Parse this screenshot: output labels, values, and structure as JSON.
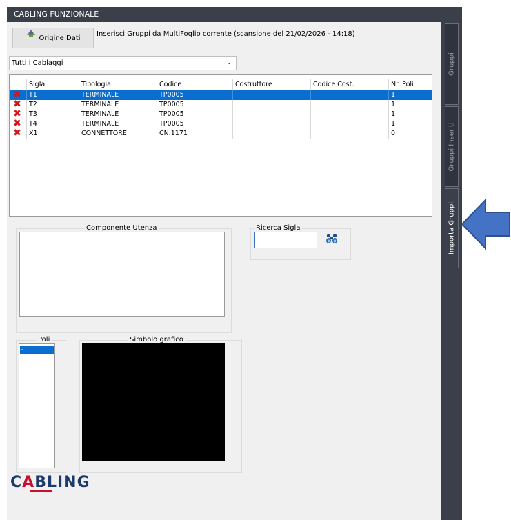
{
  "window": {
    "title": "CABLING FUNZIONALE"
  },
  "toolbar": {
    "origine_label": "Origine Dati",
    "scan_text": "Inserisci Gruppi da MultiFoglio corrente  (scansione del 21/02/2026 - 14:18)"
  },
  "filter": {
    "selected": "Tutti i Cablaggi"
  },
  "table": {
    "columns": [
      "Sigla",
      "Tipologia",
      "Codice",
      "Costruttore",
      "Codice Cost.",
      "Nr. Poli"
    ],
    "rows": [
      {
        "sigla": "T1",
        "tipologia": "TERMINALE",
        "codice": "TP0005",
        "costruttore": "",
        "codice_cost": "",
        "nr_poli": "1",
        "selected": true
      },
      {
        "sigla": "T2",
        "tipologia": "TERMINALE",
        "codice": "TP0005",
        "costruttore": "",
        "codice_cost": "",
        "nr_poli": "1",
        "selected": false
      },
      {
        "sigla": "T3",
        "tipologia": "TERMINALE",
        "codice": "TP0005",
        "costruttore": "",
        "codice_cost": "",
        "nr_poli": "1",
        "selected": false
      },
      {
        "sigla": "T4",
        "tipologia": "TERMINALE",
        "codice": "TP0005",
        "costruttore": "",
        "codice_cost": "",
        "nr_poli": "1",
        "selected": false
      },
      {
        "sigla": "X1",
        "tipologia": "CONNETTORE",
        "codice": "CN.1171",
        "costruttore": "",
        "codice_cost": "",
        "nr_poli": "0",
        "selected": false
      }
    ]
  },
  "componente_utenza": {
    "label": "Componente Utenza",
    "value": ""
  },
  "ricerca": {
    "label": "Ricerca Sigla",
    "value": ""
  },
  "poli": {
    "label": "Poli",
    "items": [
      "-"
    ]
  },
  "simbolo": {
    "label": "Simbolo grafico"
  },
  "logo": {
    "text": "CABLING"
  },
  "side_tabs": [
    {
      "label": "Gruppi",
      "active": false
    },
    {
      "label": "Gruppi Inseriti",
      "active": false
    },
    {
      "label": "Importa Gruppi",
      "active": true
    }
  ],
  "colors": {
    "selection": "#0a6ed1",
    "delete_icon": "#d2161b",
    "arrow_fill": "#4472c4",
    "logo_red": "#c8102e",
    "logo_blue": "#1d3a6e"
  }
}
